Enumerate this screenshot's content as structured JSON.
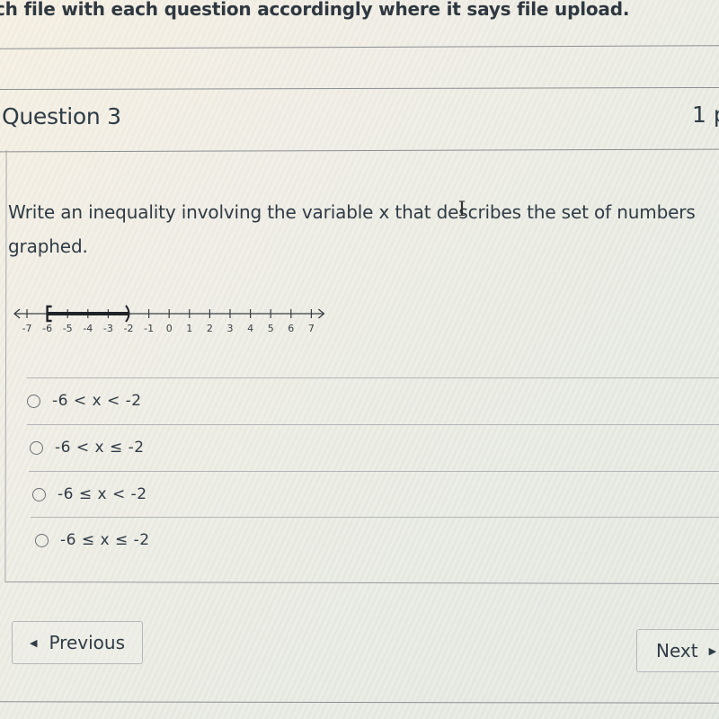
{
  "instruction_text": "ch file with each question accordingly where it says file upload.",
  "question": {
    "title": "Question 3",
    "points": "1 p",
    "prompt": "Write an inequality involving the variable x that describes the set of numbers graphed."
  },
  "number_line": {
    "min": -7,
    "max": 7,
    "tick_labels": [
      "-7",
      "-6",
      "-5",
      "-4",
      "-3",
      "-2",
      "-1",
      "0",
      "1",
      "2",
      "3",
      "4",
      "5",
      "6",
      "7"
    ],
    "shaded_from": -6,
    "shaded_to": -2,
    "left_endpoint": "closed-bracket",
    "right_endpoint": "open-paren",
    "arrows": "both"
  },
  "options": [
    {
      "label": "-6 < x < -2",
      "selected": false
    },
    {
      "label": "-6 < x ≤ -2",
      "selected": false
    },
    {
      "label": "-6 ≤ x < -2",
      "selected": false
    },
    {
      "label": "-6 ≤ x ≤ -2",
      "selected": false
    }
  ],
  "navigation": {
    "previous_label": "Previous",
    "next_label": "Next",
    "previous_icon": "triangle-left-icon",
    "next_icon": "triangle-right-icon"
  },
  "cursor": "text-ibeam-cursor"
}
